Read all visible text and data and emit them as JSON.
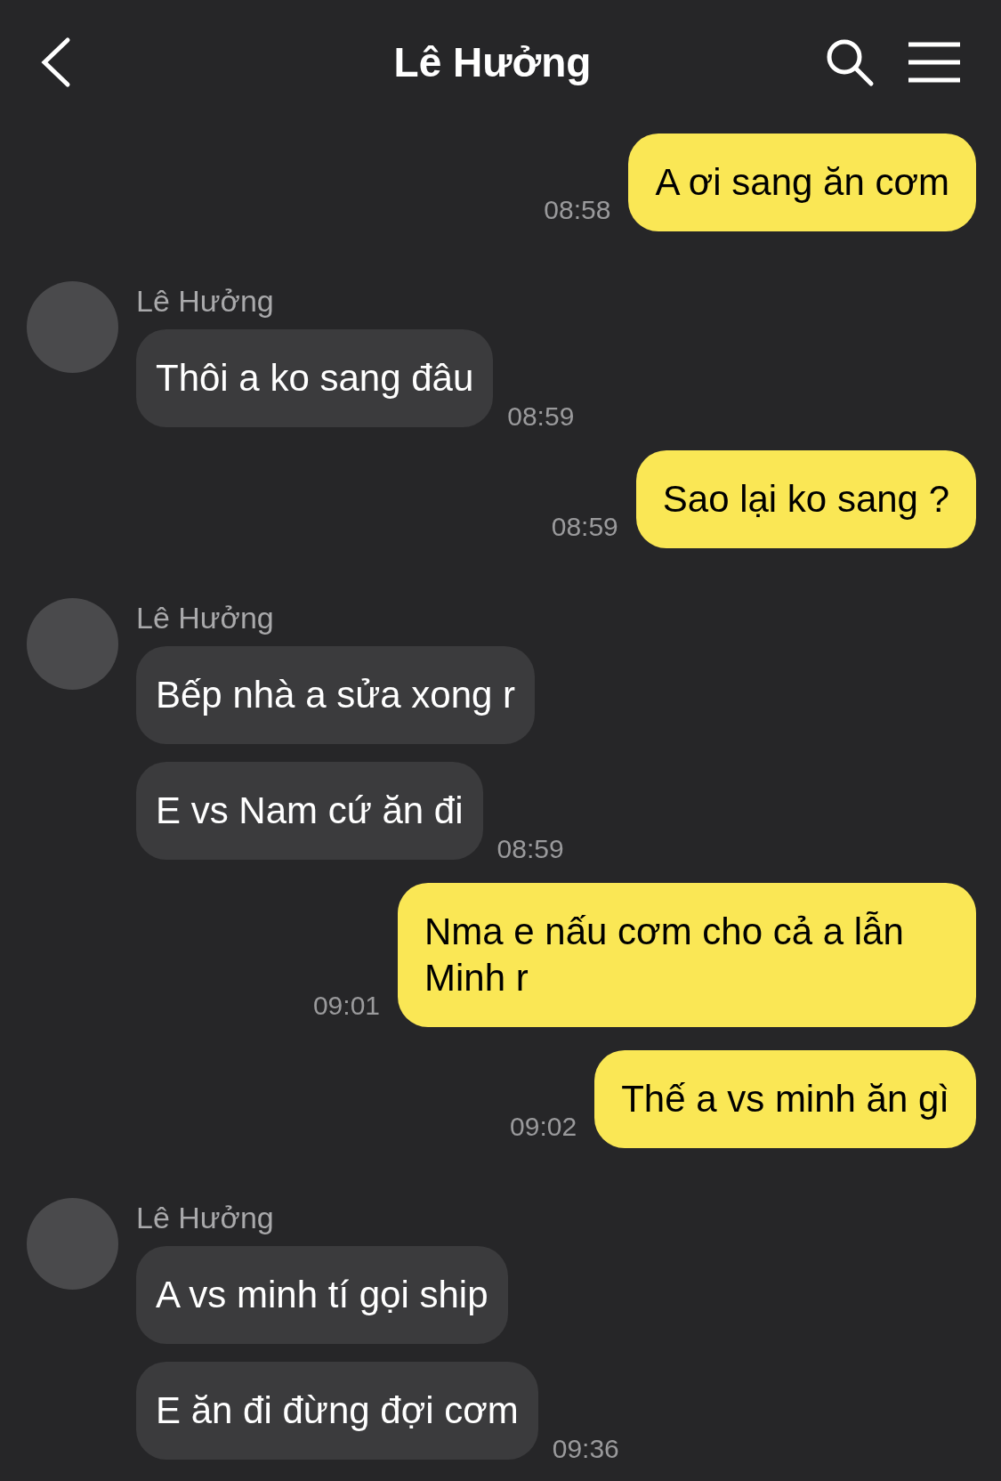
{
  "header": {
    "title": "Lê Hưởng"
  },
  "messages": [
    {
      "kind": "sent",
      "texts": [
        "A ơi sang ăn cơm"
      ],
      "time": "08:58"
    },
    {
      "kind": "received",
      "sender": "Lê Hưởng",
      "texts": [
        "Thôi a ko sang đâu"
      ],
      "time": "08:59"
    },
    {
      "kind": "sent",
      "texts": [
        "Sao lại ko sang ?"
      ],
      "time": "08:59"
    },
    {
      "kind": "received",
      "sender": "Lê Hưởng",
      "texts": [
        "Bếp nhà a sửa xong r",
        "E vs Nam cứ ăn đi"
      ],
      "time": "08:59"
    },
    {
      "kind": "sent",
      "texts": [
        "Nma e nấu cơm cho cả a lẫn Minh r"
      ],
      "time": "09:01"
    },
    {
      "kind": "sent",
      "texts": [
        "Thế a vs minh ăn gì"
      ],
      "time": "09:02"
    },
    {
      "kind": "received",
      "sender": "Lê Hưởng",
      "texts": [
        "A vs minh tí gọi ship",
        "E ăn đi đừng đợi cơm"
      ],
      "time": "09:36"
    }
  ]
}
